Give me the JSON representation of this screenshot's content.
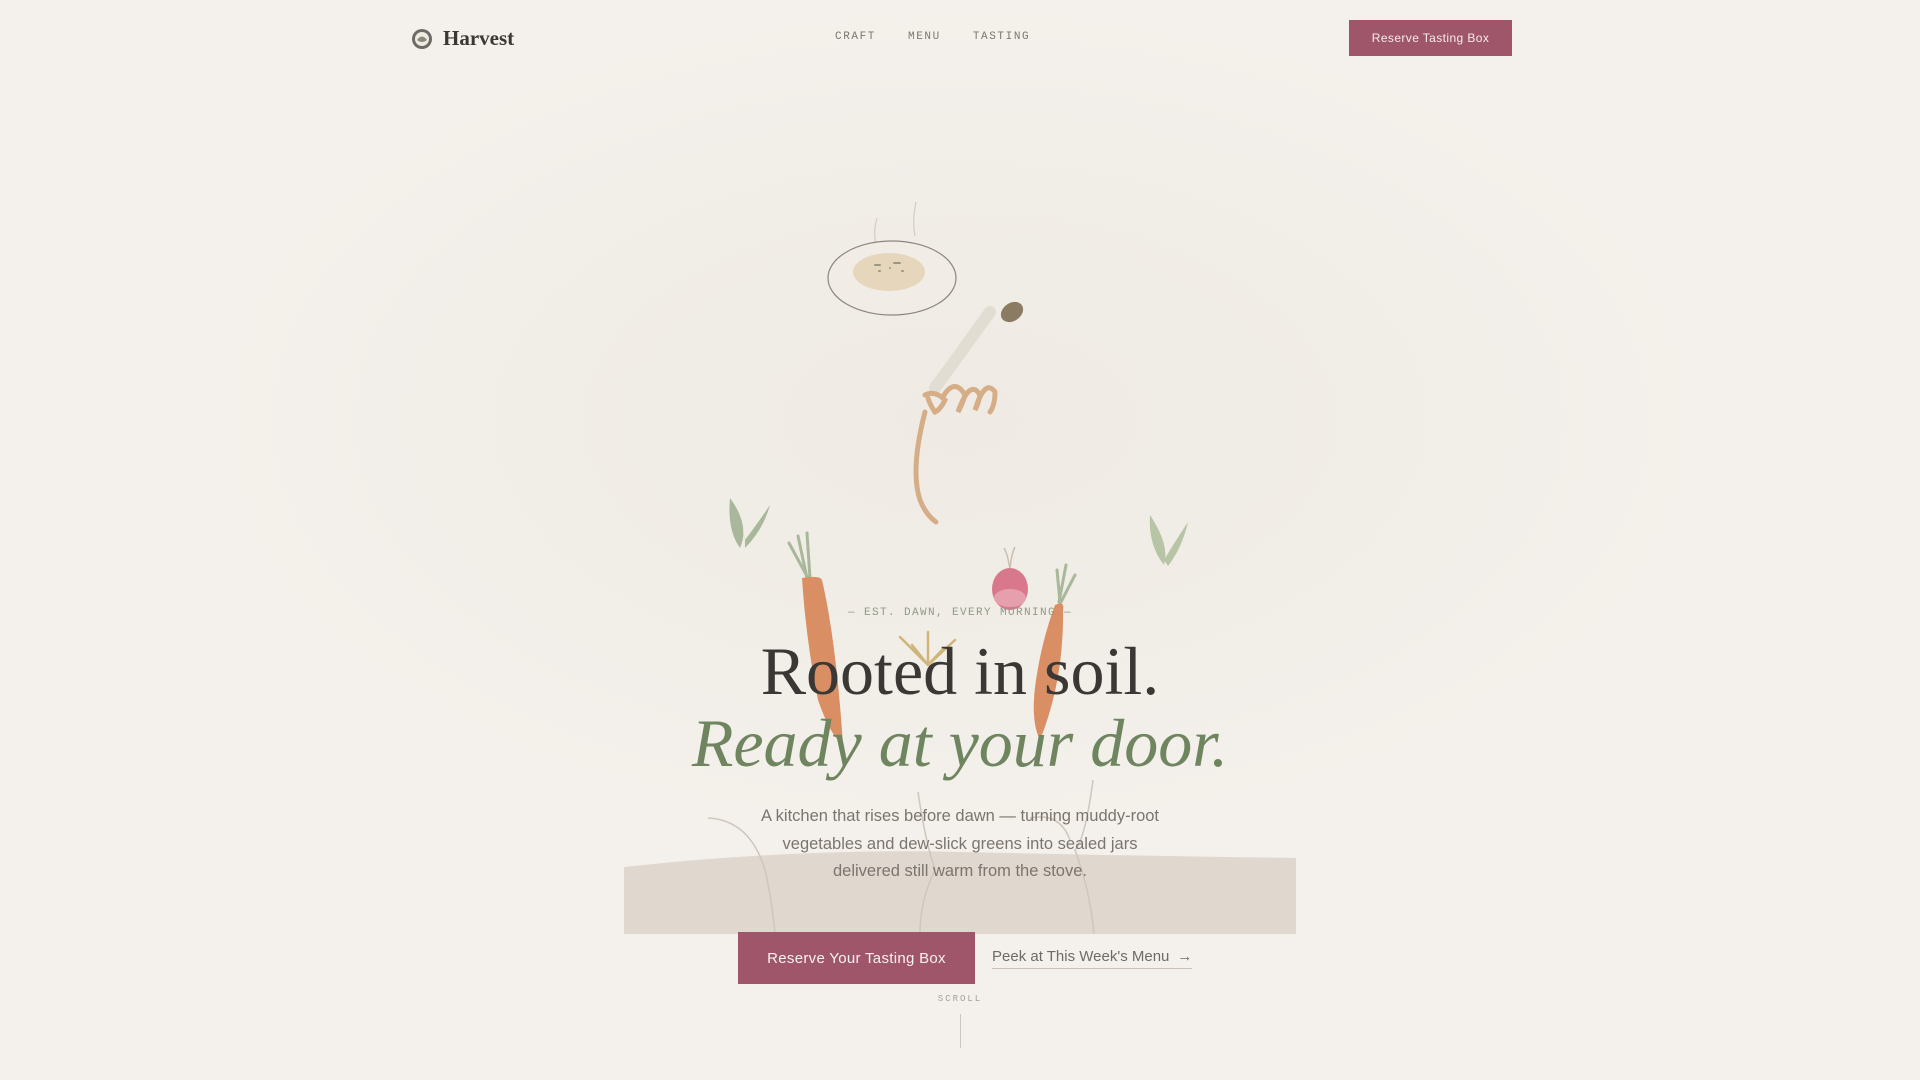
{
  "brand": {
    "name": "Harvest",
    "icon": "leaf-badge-icon"
  },
  "nav": {
    "links": [
      "CRAFT",
      "MENU",
      "TASTING"
    ],
    "cta_label": "Reserve Tasting Box"
  },
  "hero": {
    "eyebrow": "— EST. DAWN, EVERY MORNING —",
    "headline": "Rooted in soil.",
    "headline_accent": "Ready at your door.",
    "lede": "A kitchen that rises before dawn — turning muddy-root vegetables and dew-slick greens into sealed jars delivered still warm from the stove.",
    "primary_cta": "Reserve Your Tasting Box",
    "secondary_cta": "Peek at This Week's Menu",
    "secondary_icon": "→"
  },
  "scroll_hint": "SCROLL",
  "colors": {
    "background": "#f4f0eb",
    "accent_plum": "#a0566a",
    "accent_sage": "#6f8560",
    "text_dark": "#3a3734",
    "carrot": "#d98f63",
    "radish": "#d9788d",
    "soil": "#e0d7ce"
  }
}
